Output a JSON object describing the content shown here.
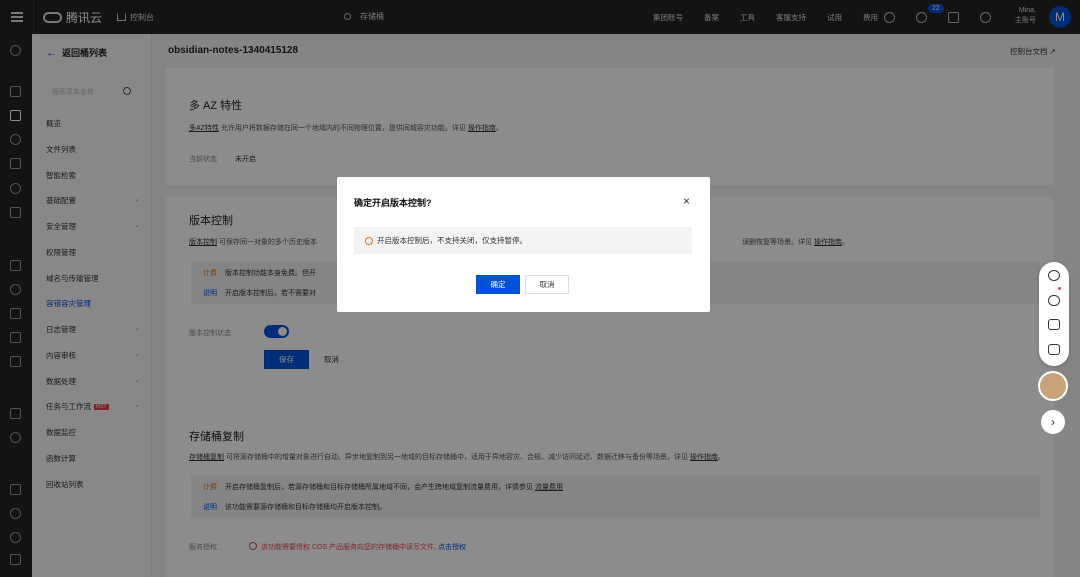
{
  "topbar": {
    "brand": "腾讯云",
    "console": "控制台",
    "search": "存储桶",
    "nav": [
      "集团账号",
      "备案",
      "工具",
      "客服支持",
      "试用",
      "费用"
    ],
    "badge_count": "22",
    "user_name": "Mina.",
    "user_role": "主账号",
    "avatar_letter": "M"
  },
  "sidebar": {
    "back": "返回桶列表",
    "search_placeholder": "搜索菜单名称",
    "items": [
      {
        "label": "概览"
      },
      {
        "label": "文件列表"
      },
      {
        "label": "智能检索"
      },
      {
        "label": "基础配置"
      },
      {
        "label": "安全管理"
      },
      {
        "label": "权限管理"
      },
      {
        "label": "域名与传输管理"
      },
      {
        "label": "容错容灾管理"
      },
      {
        "label": "日志管理"
      },
      {
        "label": "内容审核"
      },
      {
        "label": "数据处理"
      },
      {
        "label": "任务与工作流"
      },
      {
        "label": "数据监控"
      },
      {
        "label": "函数计算"
      },
      {
        "label": "回收站列表"
      }
    ],
    "hot": "HOT"
  },
  "main": {
    "bucket": "obsidian-notes-1340415128",
    "doc_link": "控制台文档",
    "multi_az": {
      "title": "多 AZ 特性",
      "desc_link": "多AZ特性",
      "desc": " 允许用户将数据存储在同一个地域内的不同物理位置，提供同城容灾功能。详见 ",
      "guide": "操作指南",
      "tail": "。",
      "status_label": "当前状态",
      "status_value": "未开启"
    },
    "versioning": {
      "title": "版本控制",
      "desc_link": "版本控制",
      "desc": " 可保存同一对象的多个历史版本",
      "desc_right": "误删恢复等场景。详见 ",
      "guide": "操作指南",
      "tail": "。",
      "fee_tag": "计费",
      "fee_text": "版本控制功能本身免费。但开",
      "note_tag": "说明",
      "note_text": "开启版本控制后，若不需要对",
      "state_label": "版本控制状态",
      "save": "保存",
      "cancel": "取消"
    },
    "replication": {
      "title": "存储桶复制",
      "desc_link": "存储桶复制",
      "desc": " 可将源存储桶中的增量对象进行自动、异步地复制到另一地域的目标存储桶中，适用于异地容灾、合规、减少访问延迟、数据迁移与备份等场景。详见 ",
      "guide": "操作指南",
      "tail": "。",
      "fee_tag": "计费",
      "fee_text": "开启存储桶复制后，若源存储桶和目标存储桶所属地域不同，会产生跨地域复制流量费用，详情参见 ",
      "fee_link": "流量费用",
      "note_tag": "说明",
      "note_text": "该功能需要源存储桶和目标存储桶均开启版本控制。",
      "auth_label": "服务授权",
      "auth_warn": "该功能需要授权 COS 产品服务向您的存储桶中读写文件,",
      "auth_link": "点击授权"
    }
  },
  "modal": {
    "title": "确定开启版本控制?",
    "close": "×",
    "alert": "开启版本控制后，不支持关闭，仅支持暂停。",
    "confirm": "确定",
    "cancel": "取消"
  }
}
